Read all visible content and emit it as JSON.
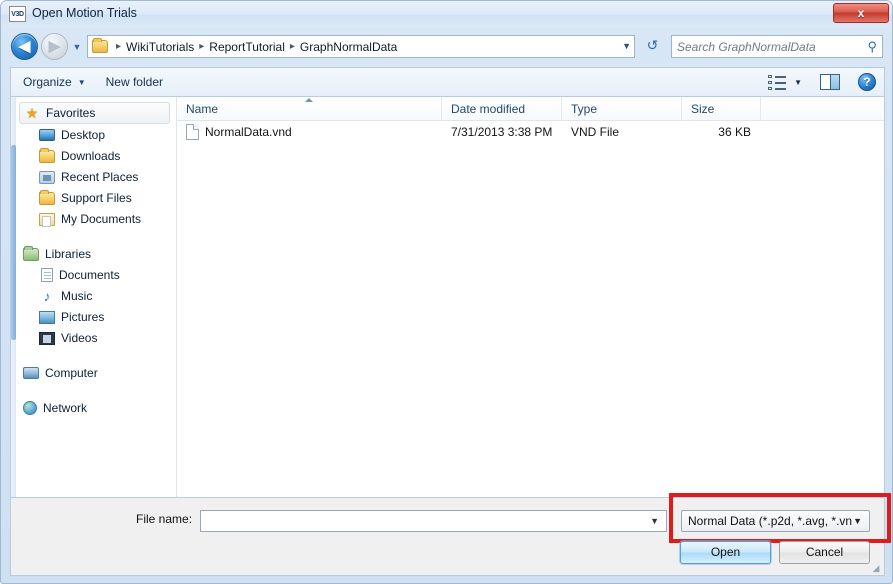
{
  "window": {
    "title": "Open Motion Trials",
    "app_icon_text": "V3D",
    "close_label": "x"
  },
  "nav": {
    "back_glyph": "◀",
    "forward_glyph": "▶",
    "history_glyph": "▼",
    "refresh_glyph": "↺",
    "breadcrumbs": [
      "WikiTutorials",
      "ReportTutorial",
      "GraphNormalData"
    ],
    "separator": "▸",
    "address_dropdown_glyph": "▼"
  },
  "search": {
    "placeholder": "Search GraphNormalData",
    "value": "",
    "icon_glyph": "⚲"
  },
  "toolbar": {
    "organize_label": "Organize",
    "organize_caret": "▼",
    "new_folder_label": "New folder",
    "view_caret": "▼",
    "help_label": "?"
  },
  "sidebar": {
    "groups": [
      {
        "header": {
          "label": "Favorites",
          "icon": "star-icon",
          "selected": true
        },
        "items": [
          {
            "label": "Desktop",
            "icon": "monitor-icon"
          },
          {
            "label": "Downloads",
            "icon": "folder-icon"
          },
          {
            "label": "Recent Places",
            "icon": "recent-places-icon"
          },
          {
            "label": "Support Files",
            "icon": "folder-icon"
          },
          {
            "label": "My Documents",
            "icon": "my-documents-icon"
          }
        ]
      },
      {
        "header": {
          "label": "Libraries",
          "icon": "library-icon",
          "selected": false
        },
        "items": [
          {
            "label": "Documents",
            "icon": "document-icon"
          },
          {
            "label": "Music",
            "icon": "music-icon"
          },
          {
            "label": "Pictures",
            "icon": "picture-icon"
          },
          {
            "label": "Videos",
            "icon": "video-icon"
          }
        ]
      },
      {
        "header": {
          "label": "Computer",
          "icon": "computer-icon",
          "selected": false
        },
        "items": []
      },
      {
        "header": {
          "label": "Network",
          "icon": "network-icon",
          "selected": false
        },
        "items": []
      }
    ]
  },
  "filelist": {
    "columns": [
      {
        "label": "Name",
        "sorted": true
      },
      {
        "label": "Date modified",
        "sorted": false
      },
      {
        "label": "Type",
        "sorted": false
      },
      {
        "label": "Size",
        "sorted": false
      }
    ],
    "rows": [
      {
        "name": "NormalData.vnd",
        "date_modified": "7/31/2013 3:38 PM",
        "type": "VND File",
        "size": "36 KB"
      }
    ]
  },
  "footer": {
    "filename_label": "File name:",
    "filename_value": "",
    "filename_caret": "▼",
    "filter_value": "Normal Data (*.p2d, *.avg, *.vn",
    "filter_caret": "▼",
    "open_label": "Open",
    "cancel_label": "Cancel",
    "resize_grip_glyph": "◢"
  },
  "annotation": {
    "highlight_color": "#e01b1b"
  }
}
